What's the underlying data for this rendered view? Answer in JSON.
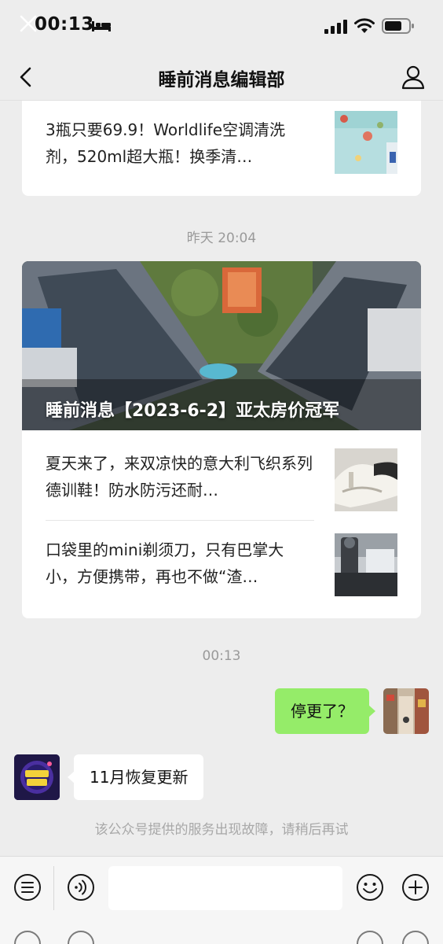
{
  "status_bar": {
    "time": "00:13"
  },
  "nav": {
    "title": "睡前消息编辑部"
  },
  "top_card": {
    "article_text": "3瓶只要69.9！Worldlife空调清洗剂，520ml超大瓶！换季清…"
  },
  "timestamp_1": "昨天 20:04",
  "main_card": {
    "hero_title": "睡前消息【2023-6-2】亚太房价冠军",
    "articles": [
      {
        "text": "夏天来了，来双凉快的意大利飞织系列德训鞋！防水防污还耐…"
      },
      {
        "text": "口袋里的mini剃须刀，只有巴掌大小，方便携带，再也不做“渣…"
      }
    ]
  },
  "timestamp_2": "00:13",
  "messages": {
    "sent": "停更了？",
    "received": "11月恢复更新"
  },
  "error_note": "该公众号提供的服务出现故障，请稍后再试",
  "colors": {
    "sent_bubble": "#95ec69",
    "background": "#ededed"
  }
}
